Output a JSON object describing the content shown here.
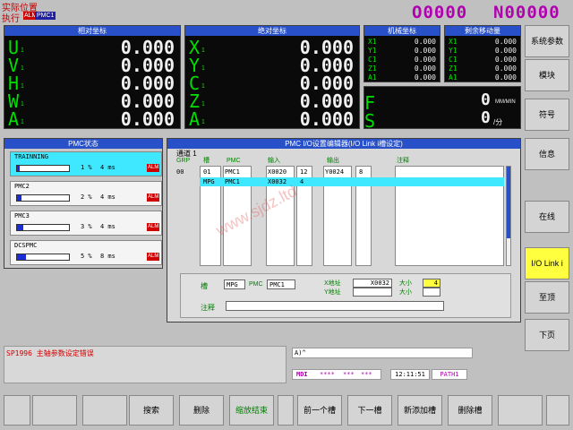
{
  "header": {
    "mode_title": "实际位置",
    "exec_label": "执行",
    "alm_badge": "ALM",
    "pmc_badge": "PMC1",
    "program_no": "O0000",
    "seq_no": "N00000"
  },
  "relative": {
    "title": "相对坐标",
    "axes": [
      {
        "name": "U",
        "sub": "1",
        "value": "0.000"
      },
      {
        "name": "V",
        "sub": "1",
        "value": "0.000"
      },
      {
        "name": "H",
        "sub": "1",
        "value": "0.000"
      },
      {
        "name": "W",
        "sub": "1",
        "value": "0.000"
      },
      {
        "name": "A",
        "sub": "1",
        "value": "0.000"
      }
    ]
  },
  "absolute": {
    "title": "绝对坐标",
    "axes": [
      {
        "name": "X",
        "sub": "1",
        "value": "0.000"
      },
      {
        "name": "Y",
        "sub": "1",
        "value": "0.000"
      },
      {
        "name": "C",
        "sub": "1",
        "value": "0.000"
      },
      {
        "name": "Z",
        "sub": "1",
        "value": "0.000"
      },
      {
        "name": "A",
        "sub": "1",
        "value": "0.000"
      }
    ]
  },
  "machine": {
    "title": "机械坐标",
    "axes": [
      {
        "name": "X1",
        "value": "0.000"
      },
      {
        "name": "Y1",
        "value": "0.000"
      },
      {
        "name": "C1",
        "value": "0.000"
      },
      {
        "name": "Z1",
        "value": "0.000"
      },
      {
        "name": "A1",
        "value": "0.000"
      }
    ]
  },
  "remaining": {
    "title": "剩余移动量",
    "axes": [
      {
        "name": "X1",
        "value": "0.000"
      },
      {
        "name": "Y1",
        "value": "0.000"
      },
      {
        "name": "C1",
        "value": "0.000"
      },
      {
        "name": "Z1",
        "value": "0.000"
      },
      {
        "name": "A1",
        "value": "0.000"
      }
    ]
  },
  "feed": {
    "f_label": "F",
    "s_label": "S",
    "f_value": "0",
    "f_unit": "MM/MIN",
    "s_value": "0",
    "s_unit": "/分"
  },
  "pmc_status": {
    "title": "PMC状态",
    "items": [
      {
        "name": "TRAINNING",
        "percent": "1 %",
        "fill": 0.05,
        "ms": "4 ms",
        "alm": "ALM"
      },
      {
        "name": "PMC2",
        "percent": "2 %",
        "fill": 0.08,
        "ms": "4 ms",
        "alm": "ALM"
      },
      {
        "name": "PMC3",
        "percent": "3 %",
        "fill": 0.12,
        "ms": "4 ms",
        "alm": "ALM"
      },
      {
        "name": "DCSPMC",
        "percent": "5 %",
        "fill": 0.18,
        "ms": "8 ms",
        "alm": "ALM"
      }
    ]
  },
  "iolink": {
    "title": "PMC I/O设置编辑器(I/O Link i槽设定)",
    "channel": "通道 1",
    "headers": {
      "grp": "GRP",
      "slot": "槽",
      "pmc": "PMC",
      "input": "输入",
      "output": "输出",
      "comment": "注释"
    },
    "rows": [
      {
        "grp": "00",
        "slot": "01",
        "pmc": "PMC1",
        "in_addr": "X0020",
        "in_size": "12",
        "out_addr": "Y0024",
        "out_size": "8"
      },
      {
        "grp": "",
        "slot": "MPG",
        "pmc": "PMC1",
        "in_addr": "X0032",
        "in_size": "4",
        "out_addr": "",
        "out_size": ""
      }
    ],
    "detail": {
      "slot_label": "槽",
      "slot_value": "MPG",
      "pmc_label": "PMC",
      "pmc_value": "PMC1",
      "x_label": "X地址",
      "x_value": "X0032",
      "y_label": "Y地址",
      "size_label1": "大小",
      "size_value": "4",
      "size_label2": "大小",
      "comment_label": "注释"
    }
  },
  "alarm_msg": "SP1996 主轴参数设定错误",
  "input_line": "A)^",
  "status_bar": {
    "mode": "MDI",
    "stars1": "****",
    "stars2": "***",
    "stars3": "***",
    "time": "12:11:51",
    "path": "PATH1"
  },
  "right_keys": [
    "系统参数",
    "模块",
    "符号",
    "信息",
    "在线",
    "I/O Link i",
    "至顶",
    "下页"
  ],
  "bottom_keys": [
    "",
    "",
    "",
    "搜索",
    "删除",
    "缩放结束",
    "",
    "前一个槽",
    "下一槽",
    "新添加槽",
    "删除槽",
    ""
  ],
  "watermark": "www.sjdz.ltd"
}
